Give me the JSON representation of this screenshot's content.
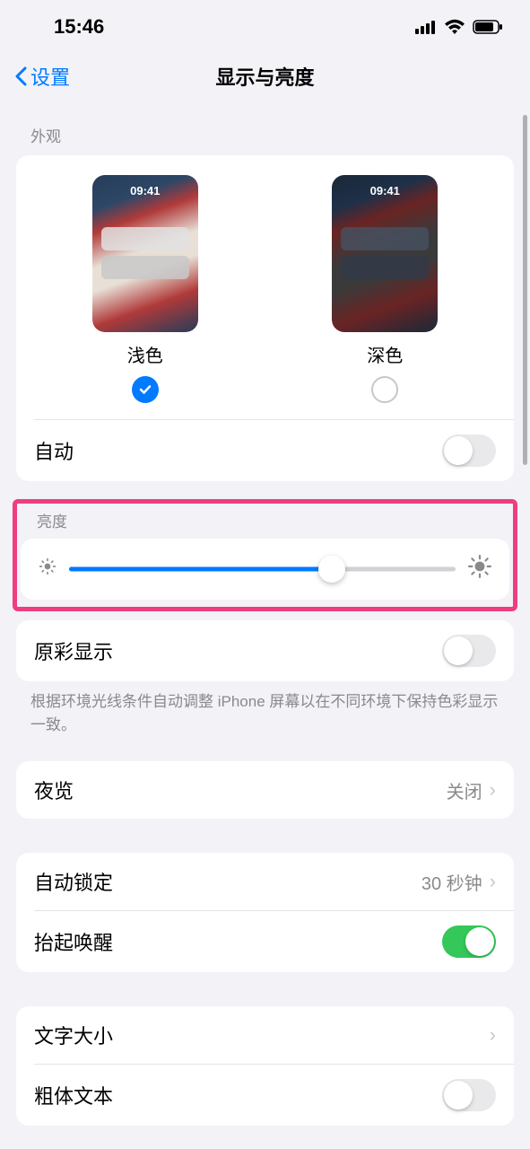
{
  "status": {
    "time": "15:46"
  },
  "nav": {
    "back": "设置",
    "title": "显示与亮度"
  },
  "appearance": {
    "header": "外观",
    "preview_time": "09:41",
    "light_label": "浅色",
    "dark_label": "深色",
    "auto_label": "自动"
  },
  "brightness": {
    "header": "亮度",
    "value_percent": 68,
    "truetone_label": "原彩显示",
    "truetone_desc": "根据环境光线条件自动调整 iPhone 屏幕以在不同环境下保持色彩显示一致。"
  },
  "night_shift": {
    "label": "夜览",
    "value": "关闭"
  },
  "auto_lock": {
    "label": "自动锁定",
    "value": "30 秒钟"
  },
  "raise_wake": {
    "label": "抬起唤醒"
  },
  "text_size": {
    "label": "文字大小"
  },
  "bold_text": {
    "label": "粗体文本"
  }
}
